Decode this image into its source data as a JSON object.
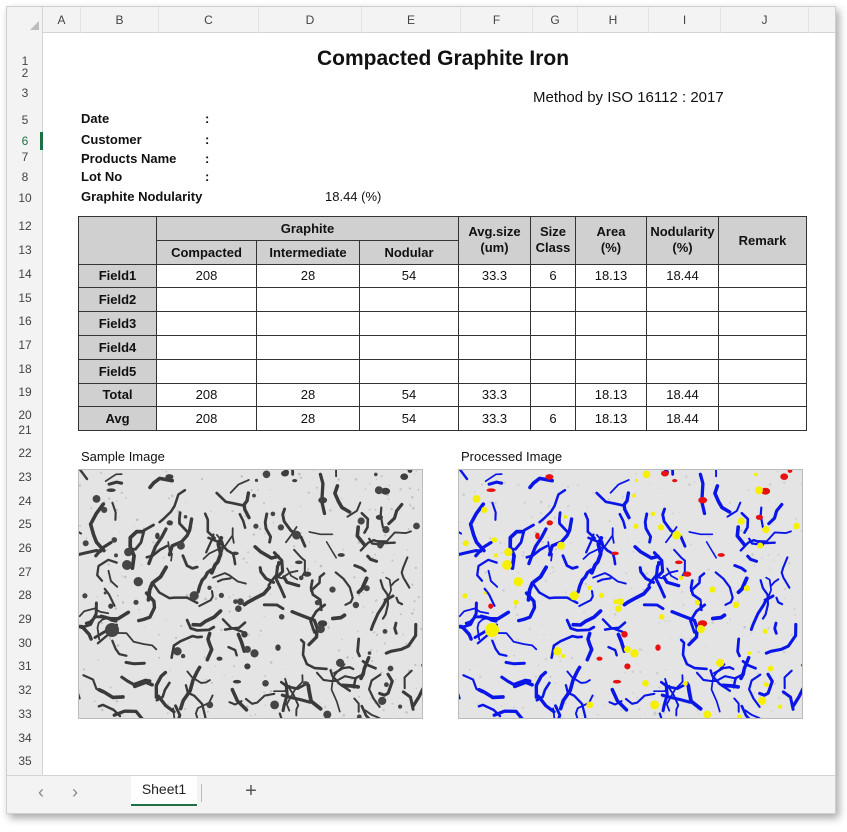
{
  "columns": [
    "A",
    "B",
    "C",
    "D",
    "E",
    "F",
    "G",
    "H",
    "I",
    "J"
  ],
  "rows": [
    "1",
    "2",
    "3",
    "5",
    "6",
    "7",
    "8",
    "10",
    "12",
    "13",
    "14",
    "15",
    "16",
    "17",
    "18",
    "19",
    "20",
    "21",
    "22",
    "23",
    "24",
    "25",
    "26",
    "27",
    "28",
    "29",
    "30",
    "31",
    "32",
    "33",
    "34",
    "35"
  ],
  "active_row": "6",
  "report": {
    "title": "Compacted Graphite Iron",
    "method": "Method by ISO 16112 : 2017",
    "info": [
      {
        "label": "Date",
        "colon": ":",
        "value": ""
      },
      {
        "label": "Customer",
        "colon": ":",
        "value": ""
      },
      {
        "label": "Products Name",
        "colon": ":",
        "value": ""
      },
      {
        "label": "Lot No",
        "colon": ":",
        "value": ""
      },
      {
        "label": "Graphite Nodularity",
        "colon": "",
        "value": "18.44  (%)"
      }
    ]
  },
  "table": {
    "header_group": "Graphite",
    "headers": {
      "compacted": "Compacted",
      "intermediate": "Intermediate",
      "nodular": "Nodular",
      "avg_size": "Avg.size\n(um)",
      "size_class": "Size\nClass",
      "area": "Area\n(%)",
      "nodularity": "Nodularity\n(%)",
      "remark": "Remark"
    },
    "rows": [
      {
        "label": "Field1",
        "cells": [
          "208",
          "28",
          "54",
          "33.3",
          "6",
          "18.13",
          "18.44",
          ""
        ]
      },
      {
        "label": "Field2",
        "cells": [
          "",
          "",
          "",
          "",
          "",
          "",
          "",
          ""
        ]
      },
      {
        "label": "Field3",
        "cells": [
          "",
          "",
          "",
          "",
          "",
          "",
          "",
          ""
        ]
      },
      {
        "label": "Field4",
        "cells": [
          "",
          "",
          "",
          "",
          "",
          "",
          "",
          ""
        ]
      },
      {
        "label": "Field5",
        "cells": [
          "",
          "",
          "",
          "",
          "",
          "",
          "",
          ""
        ]
      },
      {
        "label": "Total",
        "cells": [
          "208",
          "28",
          "54",
          "33.3",
          "",
          "18.13",
          "18.44",
          ""
        ]
      },
      {
        "label": "Avg",
        "cells": [
          "208",
          "28",
          "54",
          "33.3",
          "6",
          "18.13",
          "18.44",
          ""
        ]
      }
    ]
  },
  "images": {
    "sample_label": "Sample Image",
    "processed_label": "Processed Image"
  },
  "tabs": {
    "prev_icon": "‹",
    "next_icon": "›",
    "sheet_name": "Sheet1",
    "add_icon": "+"
  },
  "colors": {
    "compacted": "#0a16e8",
    "nodular": "#f5f000",
    "intermediate": "#e81010",
    "excel_green": "#1e7145"
  }
}
